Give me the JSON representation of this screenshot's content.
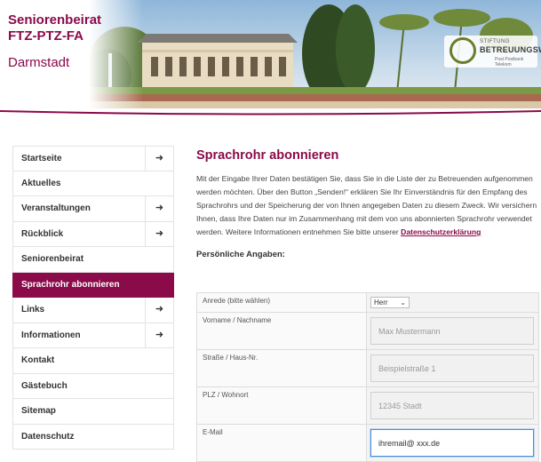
{
  "header": {
    "brand_line1": "Seniorenbeirat",
    "brand_line2": "FTZ-PTZ-FA",
    "brand_city": "Darmstadt",
    "logo_small": "STIFTUNG",
    "logo_main": "BETREUUNGSWERK",
    "logo_sub": "Post Postbank Telekom"
  },
  "colors": {
    "accent": "#8a0a4a",
    "focus": "#4a90d9"
  },
  "sidebar": {
    "items": [
      {
        "label": "Startseite",
        "arrow": "➜",
        "has_arrow": true,
        "active": false
      },
      {
        "label": "Aktuelles",
        "arrow": "",
        "has_arrow": false,
        "active": false
      },
      {
        "label": "Veranstaltungen",
        "arrow": "➜",
        "has_arrow": true,
        "active": false
      },
      {
        "label": "Rückblick",
        "arrow": "➜",
        "has_arrow": true,
        "active": false
      },
      {
        "label": "Seniorenbeirat",
        "arrow": "",
        "has_arrow": false,
        "active": false
      },
      {
        "label": "Sprachrohr abonnieren",
        "arrow": "",
        "has_arrow": false,
        "active": true
      },
      {
        "label": "Links",
        "arrow": "➜",
        "has_arrow": true,
        "active": false
      },
      {
        "label": "Informationen",
        "arrow": "➜",
        "has_arrow": true,
        "active": false
      },
      {
        "label": "Kontakt",
        "arrow": "",
        "has_arrow": false,
        "active": false
      },
      {
        "label": "Gästebuch",
        "arrow": "",
        "has_arrow": false,
        "active": false
      },
      {
        "label": "Sitemap",
        "arrow": "",
        "has_arrow": false,
        "active": false
      },
      {
        "label": "Datenschutz",
        "arrow": "",
        "has_arrow": false,
        "active": false
      }
    ]
  },
  "main": {
    "title": "Sprachrohr abonnieren",
    "paragraph": "Mit der Eingabe Ihrer Daten bestätigen Sie, dass Sie in die Liste der zu Betreuenden aufgenommen werden möchten. Über den Button „Senden!“ erklären Sie Ihr Einverständnis für den Empfang des Sprachrohrs und der Speicherung der von Ihnen angegeben Daten zu diesem Zweck. Wir versichern Ihnen, dass Ihre Daten nur im Zusammenhang mit dem von uns abonnierten Sprachrohr verwendet werden. Weitere Informationen entnehmen Sie bitte unserer",
    "privacy_link": "Datenschutzerklärung",
    "section_heading": "Persönliche Angaben:"
  },
  "form": {
    "salutation_label": "Anrede (bitte wählen)",
    "salutation_value": "Herr",
    "name_label": "Vorname / Nachname",
    "name_placeholder": "Max Mustermann",
    "street_label": "Straße / Haus-Nr.",
    "street_placeholder": "Beispielstraße 1",
    "city_label": "PLZ / Wohnort",
    "city_placeholder": "12345 Stadt",
    "email_label": "E-Mail",
    "email_value": "ihremail@ xxx.de"
  }
}
